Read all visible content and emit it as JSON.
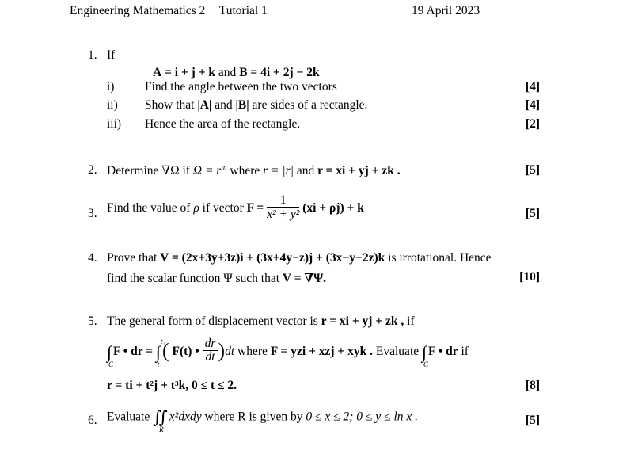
{
  "header": {
    "course": "Engineering Mathematics 2",
    "tutorial": "Tutorial 1",
    "date": "19 April 2023"
  },
  "questions": [
    {
      "number": "1.",
      "intro": "If",
      "given": {
        "A_lhs": "A",
        "A_rhs": "= i + j + k",
        "conj": "and",
        "B_lhs": "B",
        "B_rhs": "= 4i + 2j − 2k"
      },
      "parts": [
        {
          "label": "i)",
          "text": "Find the angle between the two vectors",
          "marks": "[4]"
        },
        {
          "label": "ii)",
          "text_pre": "Show that",
          "absA": "|A|",
          "and": "and",
          "absB": "|B|",
          "text_post": "are sides of a rectangle.",
          "marks": "[4]"
        },
        {
          "label": "iii)",
          "text": "Hence the area of the rectangle.",
          "marks": "[2]"
        }
      ]
    },
    {
      "number": "2.",
      "text_pre": "Determine ∇Ω if",
      "omega_expr": "Ω = r",
      "omega_exp": "m",
      "where": "where",
      "r_def": "r = |r|",
      "and": "and",
      "r_vec": "r = xi + yj + zk .",
      "marks": "[5]"
    },
    {
      "number": "3.",
      "text_pre": "Find the value of",
      "rho": "ρ",
      "text_mid": "if vector",
      "F_lhs": "F =",
      "frac_num": "1",
      "frac_den": "x² + y²",
      "rest": "(xi + ρj) + k",
      "marks": "[5]"
    },
    {
      "number": "4.",
      "line1_pre": "Prove that",
      "V_expr": "V = (2x+3y+3z)i + (3x+4y−z)j + (3x−y−2z)k",
      "line1_post": "is irrotational. Hence",
      "line2_pre": "find the scalar function",
      "psi": "Ψ",
      "line2_mid": "such that",
      "line2_eq": "V = ∇Ψ.",
      "marks": "[10]"
    },
    {
      "number": "5.",
      "line1": "The general form of displacement vector is",
      "r_vec": "r = xi + yj + zk ,",
      "line1_post": "if",
      "int_sub": "C",
      "int_lhs": "F • dr =",
      "int_lower": "t₁",
      "int_upper": "t₂",
      "integrand_pre": "F(t) •",
      "frac_num": "dr",
      "frac_den": "dt",
      "dt": "dt",
      "where": "where",
      "F_def": "F = yzi + xzj + xyk .",
      "evaluate": "Evaluate",
      "eval_int": "F • dr",
      "eval_sub": "C",
      "eval_post": "if",
      "line3": "r = ti + t²j + t³k,  0 ≤ t ≤ 2.",
      "marks": "[8]"
    },
    {
      "number": "6.",
      "text_pre": "Evaluate",
      "integrand": "x²dxdy",
      "region": "R",
      "text_mid": "where R is given by",
      "bounds": "0 ≤ x ≤ 2; 0 ≤ y ≤ ln x .",
      "marks": "[5]"
    }
  ]
}
